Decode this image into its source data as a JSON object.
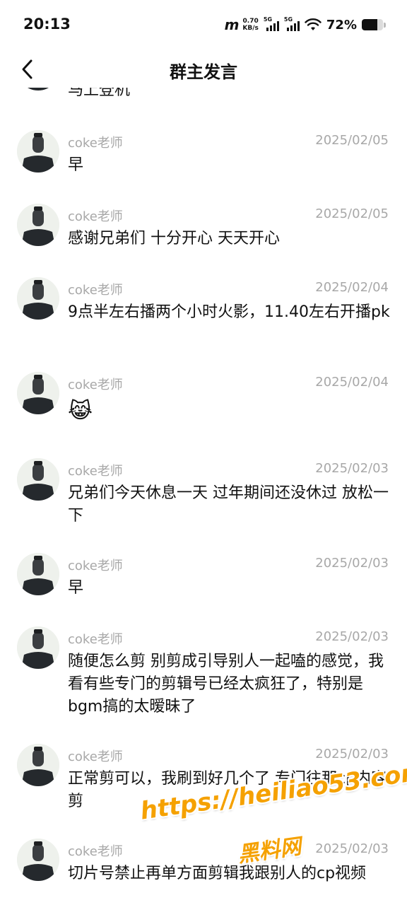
{
  "status_bar": {
    "time": "20:13",
    "net_speed_value": "0.70",
    "net_speed_unit": "KB/s",
    "sim1_label": "5G",
    "sim2_label": "5G",
    "battery_text": "72%",
    "battery_level": 0.72
  },
  "nav": {
    "title": "群主发言",
    "back_icon": "chevron-left-icon"
  },
  "messages": [
    {
      "author": "",
      "date": "",
      "text": "马上登机"
    },
    {
      "author": "coke老师",
      "date": "2025/02/05",
      "text": "早"
    },
    {
      "author": "coke老师",
      "date": "2025/02/05",
      "text": "感谢兄弟们 十分开心 天天开心"
    },
    {
      "author": "coke老师",
      "date": "2025/02/04",
      "text": "9点半左右播两个小时火影，11.40左右开播pk"
    },
    {
      "author": "coke老师",
      "date": "2025/02/04",
      "text": "😹"
    },
    {
      "author": "coke老师",
      "date": "2025/02/03",
      "text": "兄弟们今天休息一天 过年期间还没休过 放松一下"
    },
    {
      "author": "coke老师",
      "date": "2025/02/03",
      "text": "早"
    },
    {
      "author": "coke老师",
      "date": "2025/02/03",
      "text": "随便怎么剪 别剪成引导别人一起嗑的感觉，我看有些专门的剪辑号已经太疯狂了，特别是bgm搞的太暧昧了"
    },
    {
      "author": "coke老师",
      "date": "2025/02/03",
      "text": "正常剪可以，我刷到好几个了 专门往那cp内容剪"
    },
    {
      "author": "coke老师",
      "date": "2025/02/03",
      "text": "切片号禁止再单方面剪辑我跟别人的cp视频"
    }
  ],
  "watermark": {
    "url": "https://heiliao53.com",
    "brand": "黑料网"
  },
  "colors": {
    "meta_text": "#a8a8a8",
    "body_text": "#111111",
    "watermark": "#f5a100"
  }
}
